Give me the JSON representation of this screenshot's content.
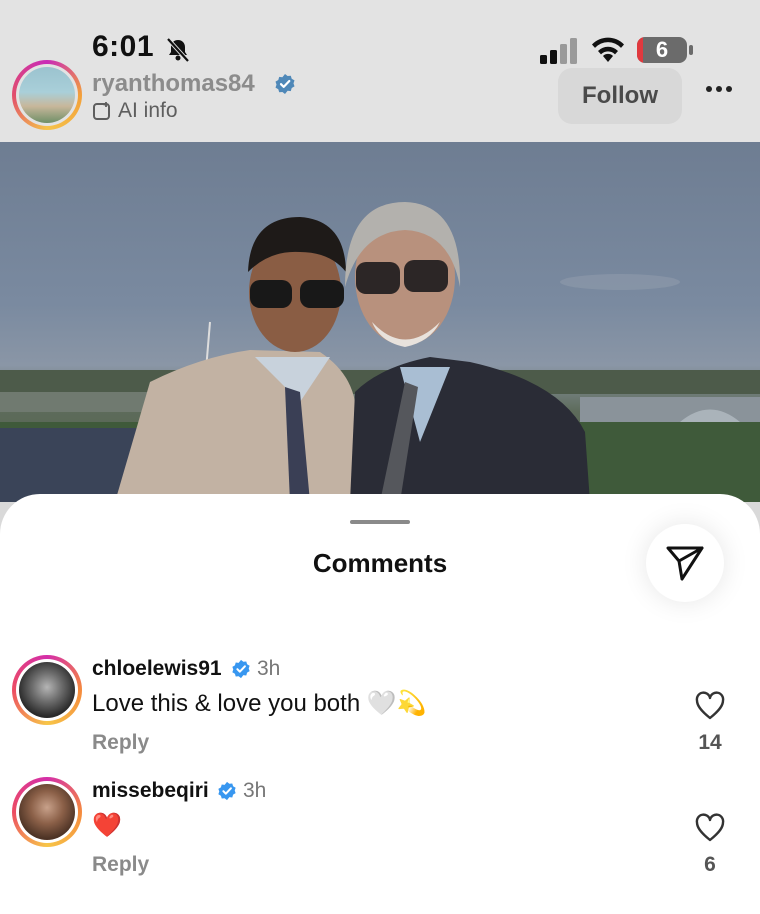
{
  "status_bar": {
    "time": "6:01",
    "battery": "6"
  },
  "post_header": {
    "username": "ryanthomas84",
    "ai_info": "AI info",
    "follow_label": "Follow",
    "more_icon": "ellipsis-icon"
  },
  "sheet": {
    "title": "Comments",
    "share_icon": "paper-plane-icon"
  },
  "comments": [
    {
      "username": "chloelewis91",
      "time": "3h",
      "text": "Love this & love you both 🤍💫",
      "reply_label": "Reply",
      "like_count": "14"
    },
    {
      "username": "missebeqiri",
      "time": "3h",
      "text": "❤️",
      "reply_label": "Reply",
      "like_count": "6"
    }
  ],
  "colors": {
    "verified": "#3897f0",
    "story_ring_start": "#c92bb7",
    "story_ring_end": "#f5c34a"
  }
}
